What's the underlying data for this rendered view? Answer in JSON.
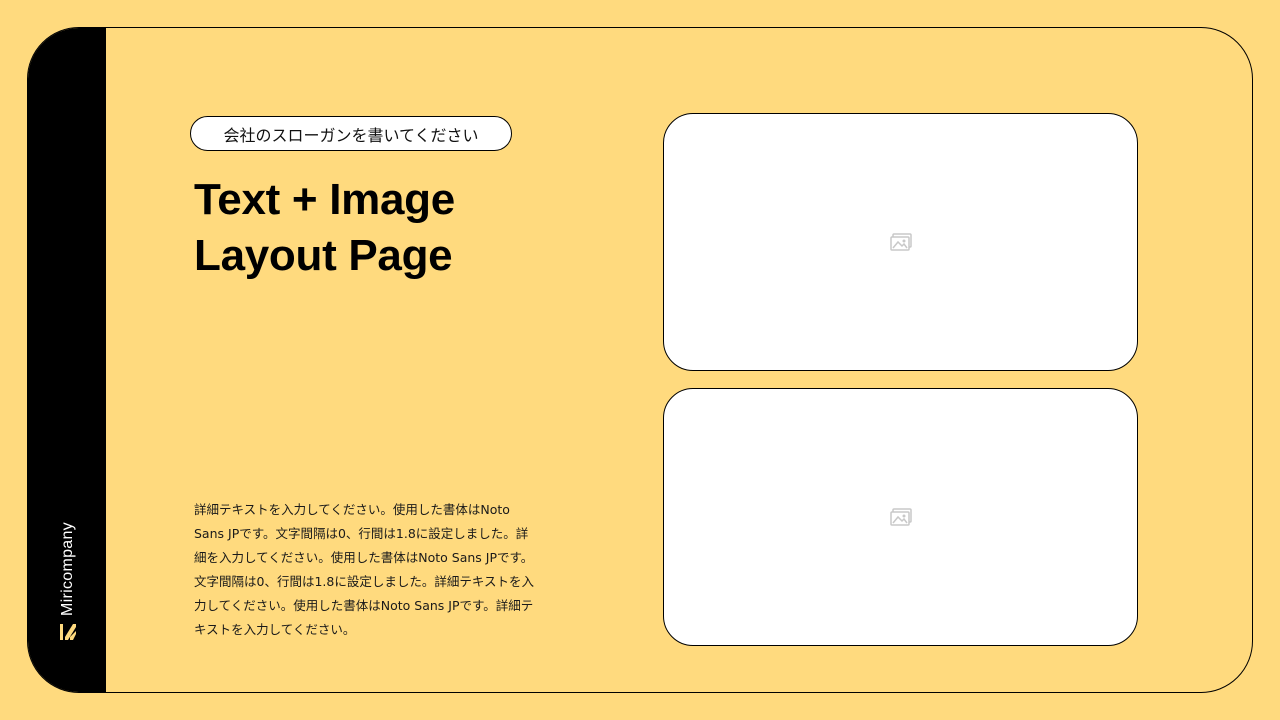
{
  "brand": {
    "name": "Miricompany"
  },
  "slide": {
    "slogan": "会社のスローガンを書いてください",
    "title_line1": "Text + Image",
    "title_line2": "Layout Page",
    "body": "詳細テキストを入力してください。使用した書体はNoto Sans JPです。文字間隔は0、行間は1.8に設定しました。詳細を入力してください。使用した書体はNoto Sans JPです。文字間隔は0、行間は1.8に設定しました。詳細テキストを入力してください。使用した書体はNoto Sans JPです。詳細テキストを入力してください。"
  },
  "images": [
    {
      "icon": "image-placeholder-icon"
    },
    {
      "icon": "image-placeholder-icon"
    }
  ],
  "colors": {
    "background": "#FFDA7E",
    "sidebar": "#000000",
    "logo_accent": "#FFDA7E",
    "card_border": "#000000",
    "image_fill": "#FFFFFF"
  }
}
